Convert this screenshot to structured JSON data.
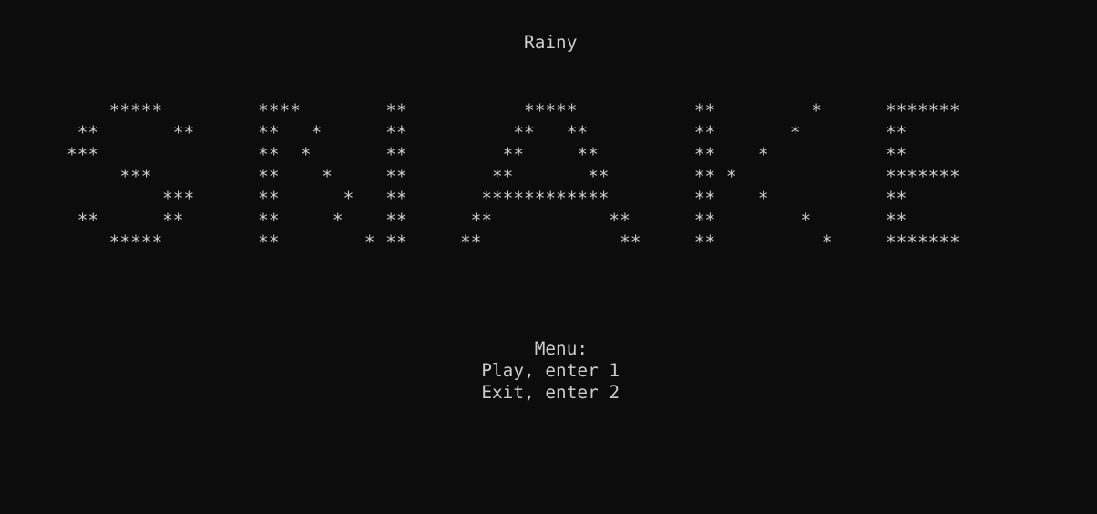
{
  "title": "                                                 Rainy",
  "banner": [
    "          *****         ****        **           *****           **         *      *******",
    "       **       **      **   *      **          **   **          **       *        **",
    "      ***               **  *       **         **     **         **    *           **",
    "           ***          **    *     **        **       **        ** *              *******",
    "               ***      **      *   **       ************        **    *           **",
    "       **      **       **     *    **      **           **      **        *       **",
    "          *****         **        * **     **             **     **          *     *******"
  ],
  "menu": {
    "heading": "                                                  Menu:",
    "option_play": "                                             Play, enter 1",
    "option_exit": "                                             Exit, enter 2"
  }
}
